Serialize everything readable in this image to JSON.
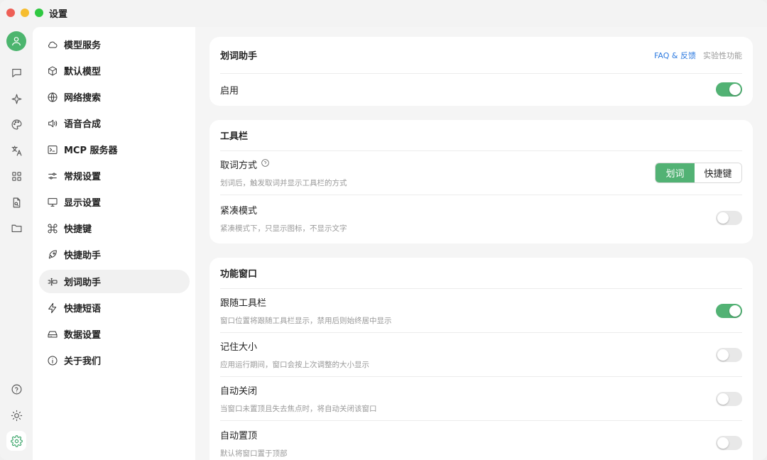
{
  "window": {
    "title": "设置"
  },
  "rail": {
    "items": [
      {
        "icon": "user-icon"
      },
      {
        "icon": "chat-icon"
      },
      {
        "icon": "sparkle-icon"
      },
      {
        "icon": "palette-icon"
      },
      {
        "icon": "translate-icon"
      },
      {
        "icon": "grid-icon"
      },
      {
        "icon": "file-search-icon"
      },
      {
        "icon": "folder-icon"
      },
      {
        "icon": "help-icon"
      },
      {
        "icon": "brightness-icon"
      },
      {
        "icon": "gear-icon"
      }
    ]
  },
  "nav": {
    "items": [
      {
        "label": "模型服务",
        "icon": "cloud-icon"
      },
      {
        "label": "默认模型",
        "icon": "cube-icon"
      },
      {
        "label": "网络搜索",
        "icon": "globe-icon"
      },
      {
        "label": "语音合成",
        "icon": "speaker-icon"
      },
      {
        "label": "MCP 服务器",
        "icon": "terminal-icon"
      },
      {
        "label": "常规设置",
        "icon": "sliders-icon"
      },
      {
        "label": "显示设置",
        "icon": "monitor-icon"
      },
      {
        "label": "快捷键",
        "icon": "command-icon"
      },
      {
        "label": "快捷助手",
        "icon": "rocket-icon"
      },
      {
        "label": "划词助手",
        "icon": "text-select-icon",
        "active": true
      },
      {
        "label": "快捷短语",
        "icon": "zap-icon"
      },
      {
        "label": "数据设置",
        "icon": "hard-drive-icon"
      },
      {
        "label": "关于我们",
        "icon": "info-icon"
      }
    ]
  },
  "section1": {
    "title": "划词助手",
    "faq_link": "FAQ & 反馈",
    "experimental": "实验性功能",
    "enable_label": "启用",
    "enable_on": true
  },
  "section2": {
    "title": "工具栏",
    "pick_label": "取词方式",
    "pick_desc": "划词后，触发取词并显示工具栏的方式",
    "pick_options": [
      "划词",
      "快捷键"
    ],
    "pick_selected": "划词",
    "compact_label": "紧凑模式",
    "compact_desc": "紧凑模式下，只显示图标，不显示文字",
    "compact_on": false
  },
  "section3": {
    "title": "功能窗口",
    "rows": [
      {
        "label": "跟随工具栏",
        "desc": "窗口位置将跟随工具栏显示，禁用后则始终居中显示",
        "on": true
      },
      {
        "label": "记住大小",
        "desc": "应用运行期间，窗口会按上次调整的大小显示",
        "on": false
      },
      {
        "label": "自动关闭",
        "desc": "当窗口未置顶且失去焦点时，将自动关闭该窗口",
        "on": false
      },
      {
        "label": "自动置顶",
        "desc": "默认将窗口置于顶部",
        "on": false
      }
    ]
  },
  "colors": {
    "accent": "#52b274",
    "link": "#2e7be0"
  }
}
